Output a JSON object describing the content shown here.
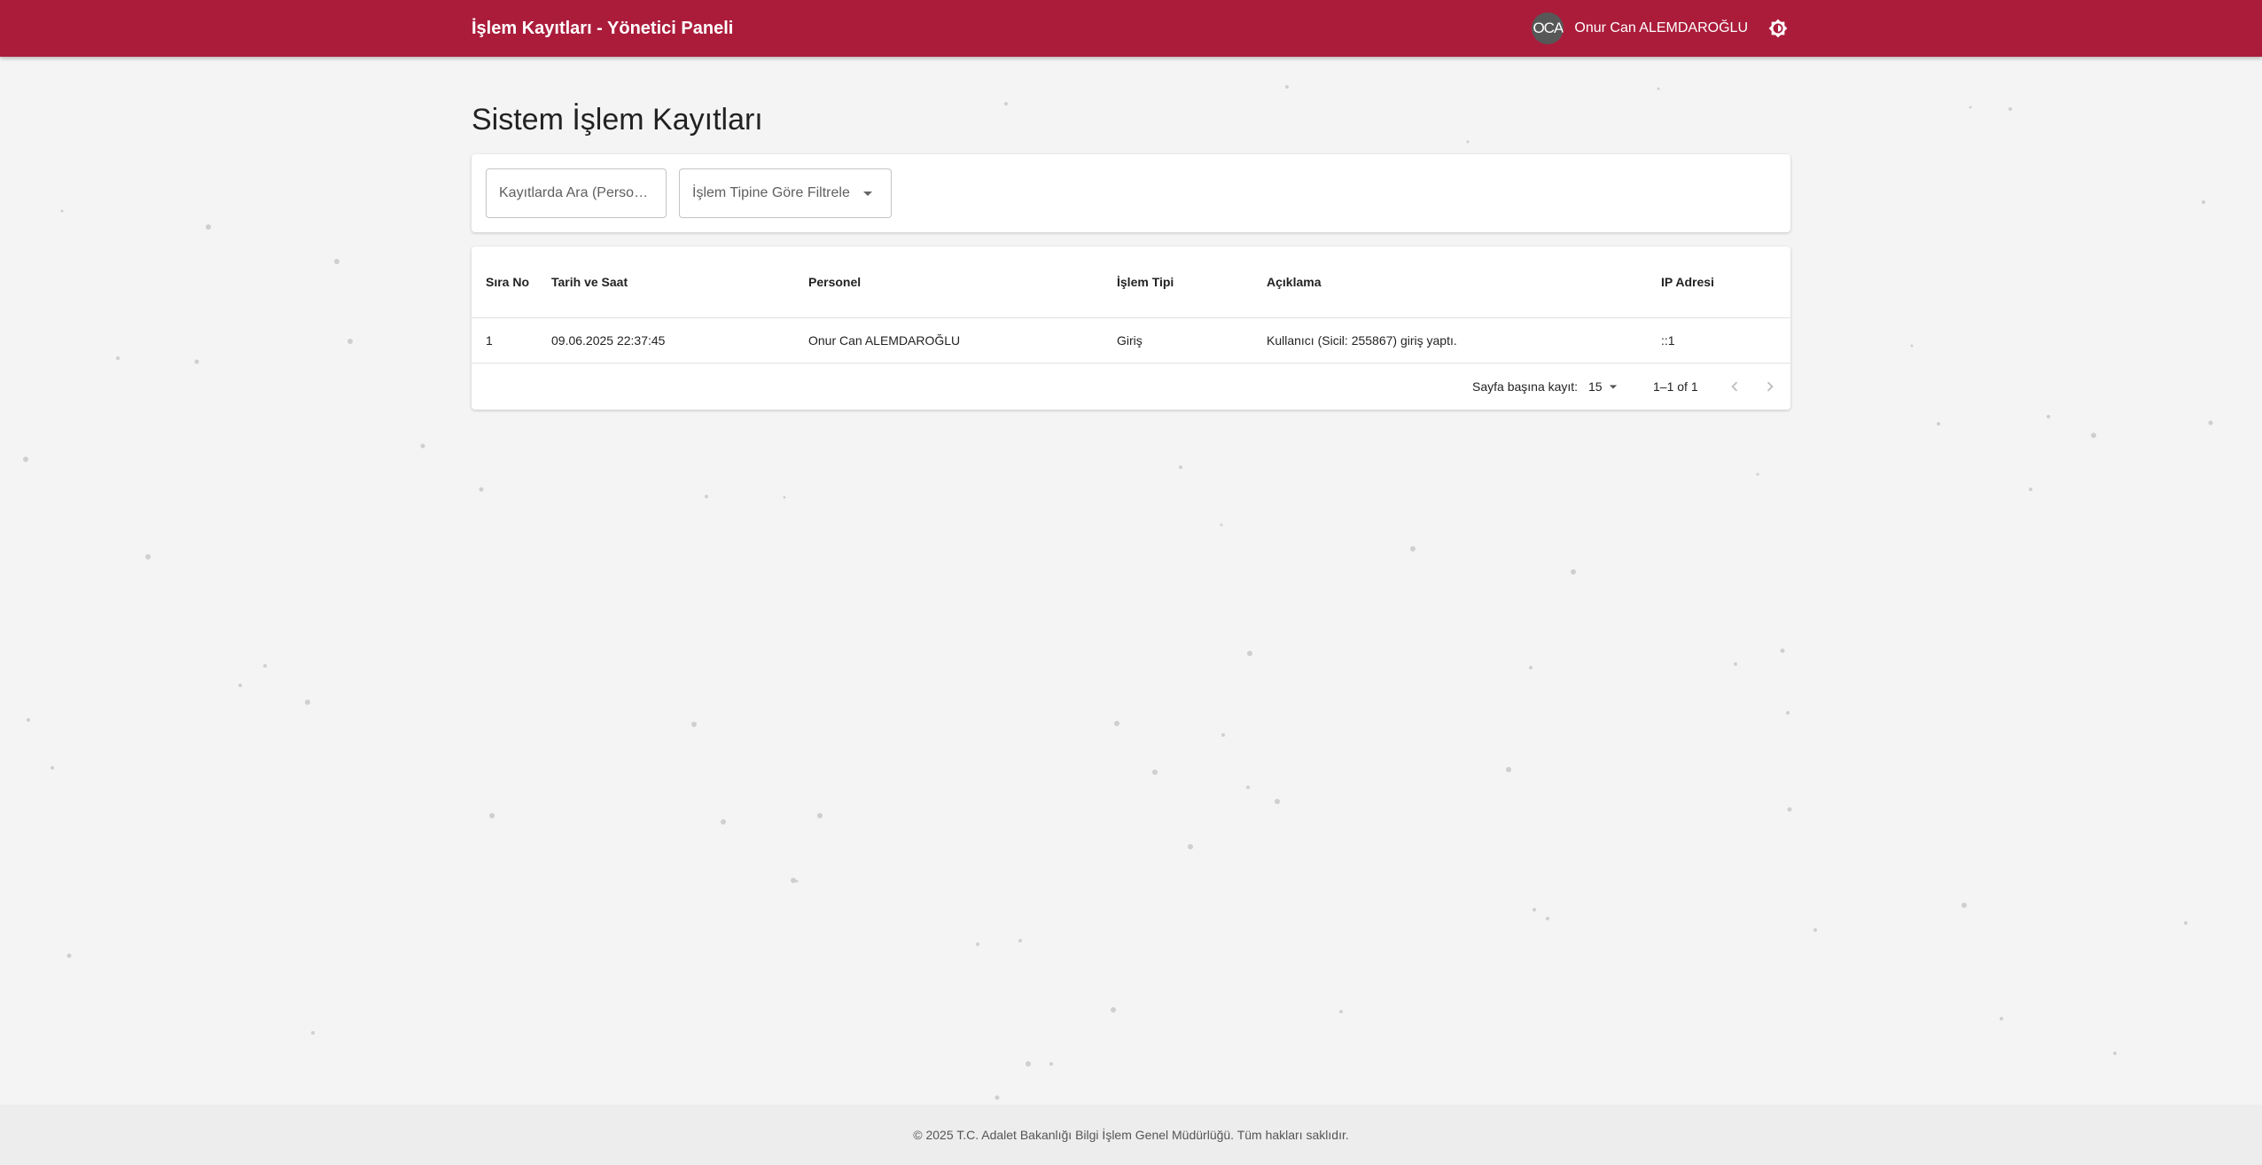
{
  "app": {
    "title": "İşlem Kayıtları - Yönetici Paneli"
  },
  "user": {
    "initials": "OCA",
    "name": "Onur Can ALEMDAROĞLU"
  },
  "icons": {
    "theme_toggle": "brightness-icon",
    "dropdown": "arrow-drop-down-icon",
    "prev": "chevron-left-icon",
    "next": "chevron-right-icon"
  },
  "colors": {
    "appbar": "#ab1c3b",
    "background": "#f4f4f4"
  },
  "page": {
    "title": "Sistem İşlem Kayıtları"
  },
  "filters": {
    "search_placeholder": "Kayıtlarda Ara (Personel, Açıklama...)",
    "search_value": "",
    "type_placeholder": "İşlem Tipine Göre Filtrele"
  },
  "table": {
    "columns": {
      "seq": "Sıra No",
      "datetime": "Tarih ve Saat",
      "personnel": "Personel",
      "type": "İşlem Tipi",
      "description": "Açıklama",
      "ip": "IP Adresi"
    },
    "rows": [
      {
        "seq": "1",
        "datetime": "09.06.2025 22:37:45",
        "personnel": "Onur Can ALEMDAROĞLU",
        "type": "Giriş",
        "description": "Kullanıcı (Sicil: 255867) giriş yaptı.",
        "ip": "::1"
      }
    ]
  },
  "pagination": {
    "rows_per_page_label": "Sayfa başına kayıt:",
    "rows_per_page": "15",
    "range": "1–1 of 1"
  },
  "footer": {
    "text": "© 2025 T.C. Adalet Bakanlığı Bilgi İşlem Genel Müdürlüğü. Tüm hakları saklıdır."
  }
}
